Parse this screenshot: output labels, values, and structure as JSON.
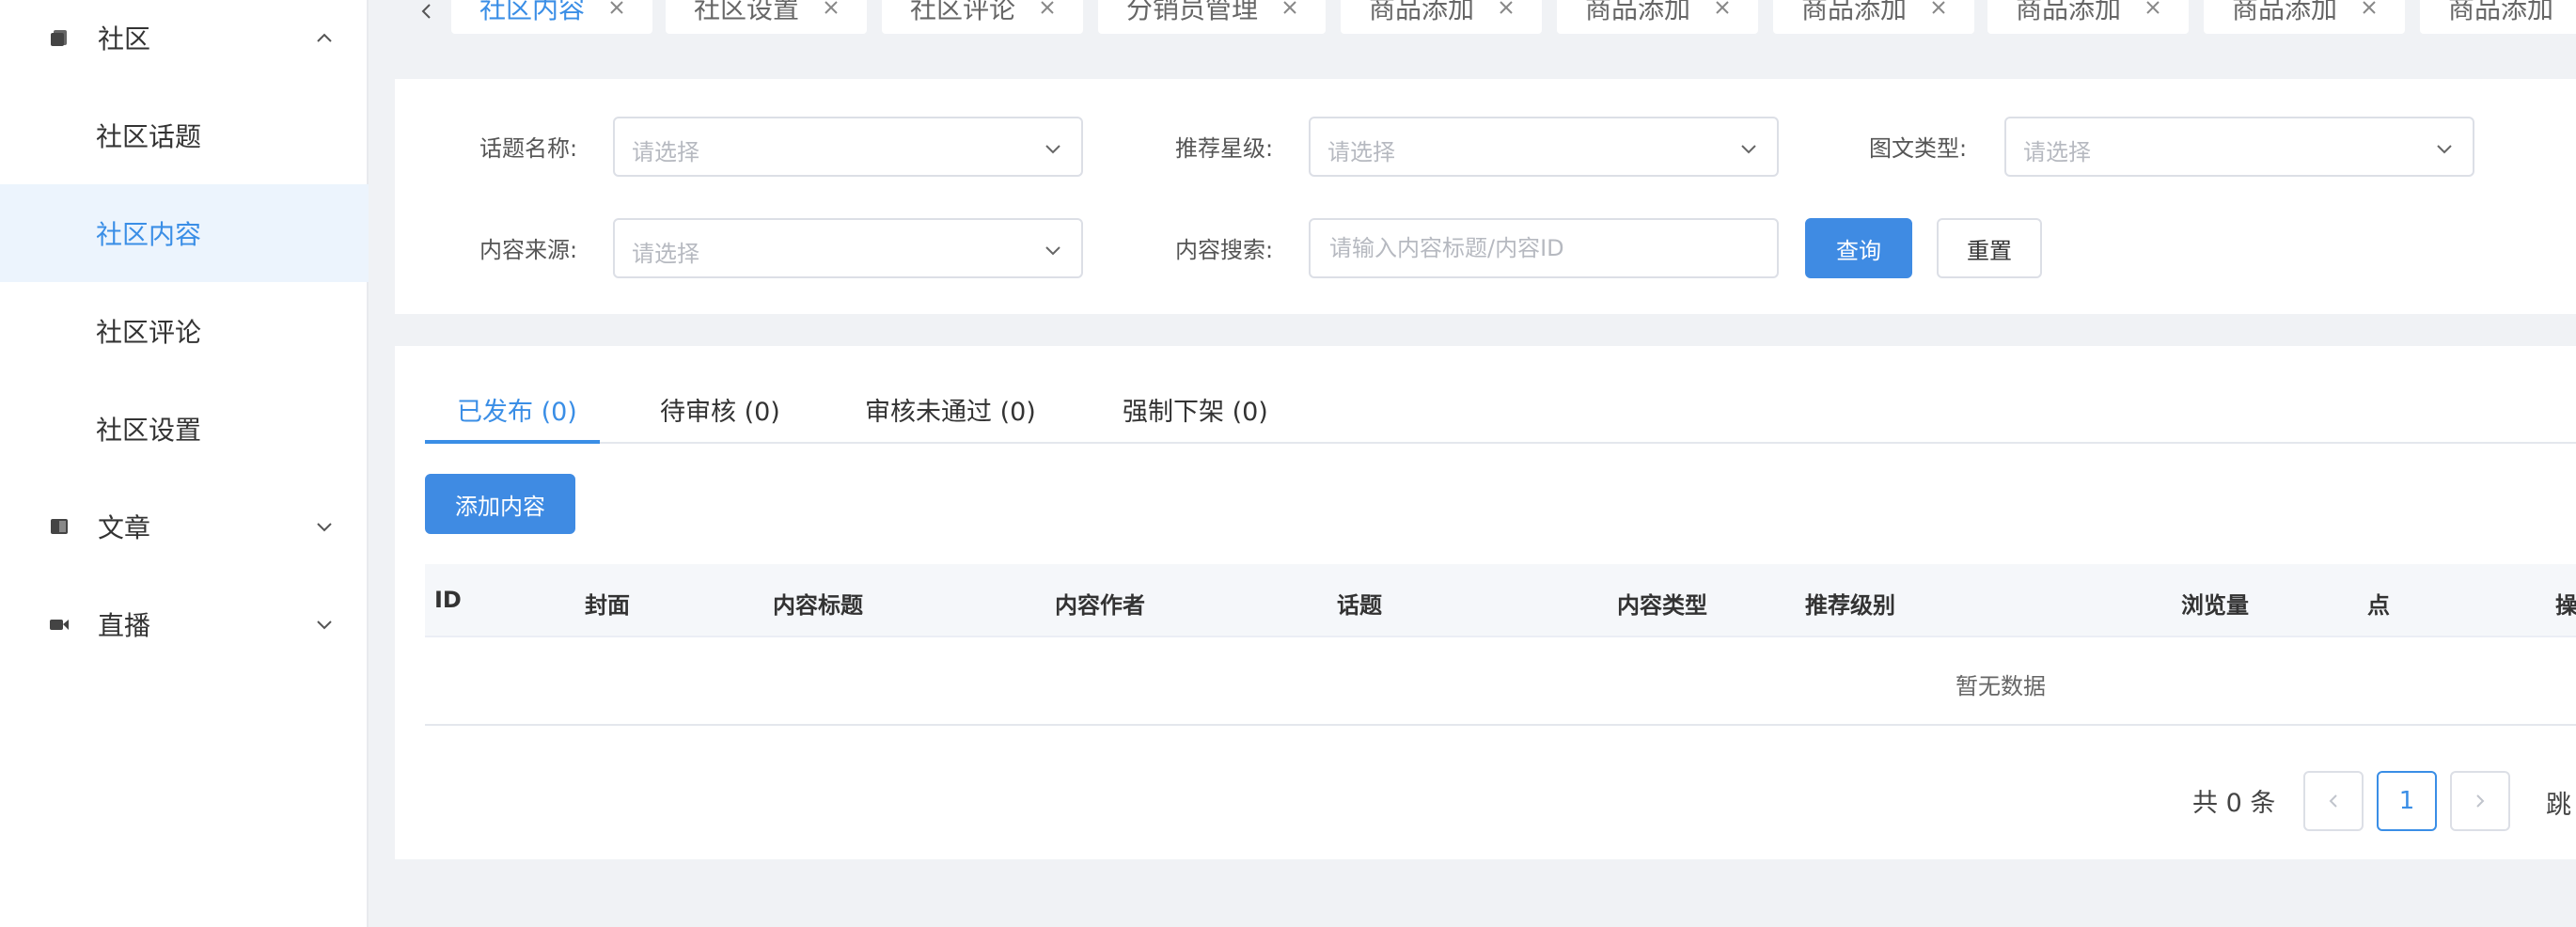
{
  "sidebar": {
    "groups": [
      {
        "label": "社区",
        "icon": "community-icon",
        "expanded": true
      },
      {
        "label": "文章",
        "icon": "article-icon",
        "expanded": false
      },
      {
        "label": "直播",
        "icon": "live-icon",
        "expanded": false
      }
    ],
    "items": [
      {
        "label": "社区话题",
        "active": false
      },
      {
        "label": "社区内容",
        "active": true
      },
      {
        "label": "社区评论",
        "active": false
      },
      {
        "label": "社区设置",
        "active": false
      }
    ]
  },
  "page_tabs": [
    {
      "label": "社区内容",
      "active": true
    },
    {
      "label": "社区设置",
      "active": false
    },
    {
      "label": "社区评论",
      "active": false
    },
    {
      "label": "分销员管理",
      "active": false
    },
    {
      "label": "商品添加",
      "active": false
    },
    {
      "label": "商品添加",
      "active": false
    },
    {
      "label": "商品添加",
      "active": false
    },
    {
      "label": "商品添加",
      "active": false
    },
    {
      "label": "商品添加",
      "active": false
    },
    {
      "label": "商品添加",
      "active": false
    }
  ],
  "filters": {
    "topic_label": "话题名称:",
    "topic_placeholder": "请选择",
    "star_label": "推荐星级:",
    "star_placeholder": "请选择",
    "type_label": "图文类型:",
    "type_placeholder": "请选择",
    "source_label": "内容来源:",
    "source_placeholder": "请选择",
    "search_label": "内容搜索:",
    "search_placeholder": "请输入内容标题/内容ID",
    "search_value": "",
    "query_button": "查询",
    "reset_button": "重置"
  },
  "status_tabs": [
    {
      "label": "已发布 (0)",
      "active": true
    },
    {
      "label": "待审核 (0)",
      "active": false
    },
    {
      "label": "审核未通过 (0)",
      "active": false
    },
    {
      "label": "强制下架 (0)",
      "active": false
    }
  ],
  "add_button": "添加内容",
  "table": {
    "columns": [
      "ID",
      "封面",
      "内容标题",
      "内容作者",
      "话题",
      "内容类型",
      "推荐级别",
      "浏览量",
      "点",
      "操"
    ],
    "rows": [],
    "empty_text": "暂无数据"
  },
  "pagination": {
    "total_text": "共 0 条",
    "current_page": "1",
    "jump_text": "跳"
  },
  "colors": {
    "primary": "#3f8be3",
    "active_text": "#3a8ee6",
    "active_bg": "#ecf4fd",
    "page_bg": "#f0f2f5"
  }
}
